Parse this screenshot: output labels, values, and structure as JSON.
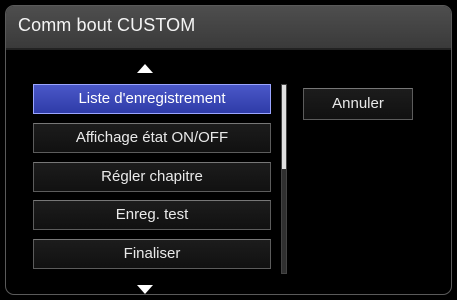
{
  "window": {
    "title": "Comm bout CUSTOM"
  },
  "menu": {
    "items": [
      {
        "label": "Liste d'enregistrement",
        "selected": true
      },
      {
        "label": "Affichage état ON/OFF",
        "selected": false
      },
      {
        "label": "Régler chapitre",
        "selected": false
      },
      {
        "label": "Enreg. test",
        "selected": false
      },
      {
        "label": "Finaliser",
        "selected": false
      }
    ],
    "up_icon": "triangle-up-icon",
    "down_icon": "triangle-down-icon"
  },
  "actions": {
    "cancel_label": "Annuler"
  },
  "colors": {
    "selected": "#3a47b8",
    "title_bar": "#464646",
    "background": "#000000"
  }
}
